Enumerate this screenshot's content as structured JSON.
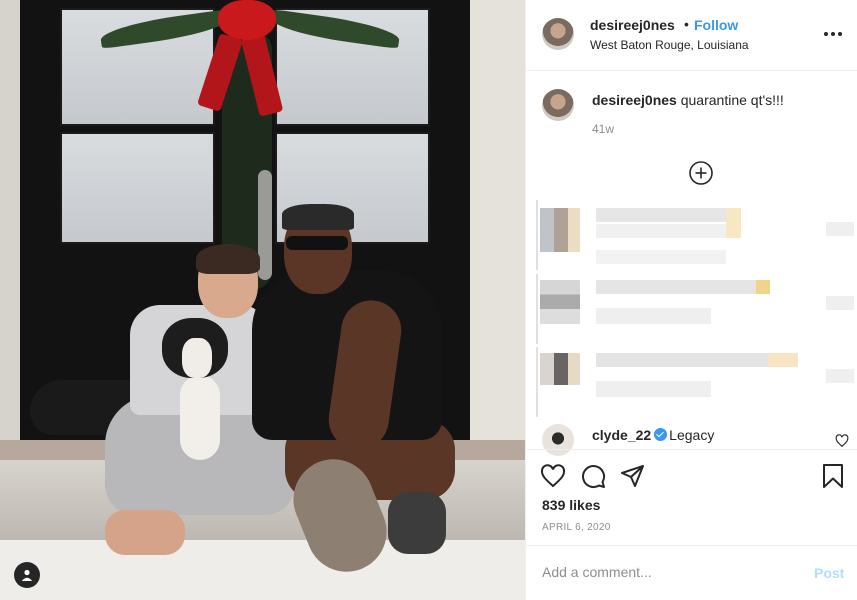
{
  "post": {
    "username": "desireej0nes",
    "separator": "•",
    "follow_label": "Follow",
    "location": "West Baton Rouge, Louisiana",
    "caption_user": "desireej0nes",
    "caption_text": "quarantine qt's!!!",
    "caption_time": "41w",
    "likes": "839 likes",
    "date": "APRIL 6, 2020"
  },
  "comments": {
    "visible_comment_user": "clyde_22",
    "visible_comment_text": "Legacy",
    "verified": true
  },
  "add_comment": {
    "placeholder": "Add a comment...",
    "post_label": "Post"
  },
  "icons": {
    "more": "more-options-icon",
    "load_more": "plus-circle-icon",
    "like": "heart-icon",
    "comment": "comment-icon",
    "share": "paper-plane-icon",
    "save": "bookmark-icon",
    "user": "user-tag-icon"
  },
  "colors": {
    "accent": "#3897f0",
    "post_disabled": "#b2dffc",
    "muted": "#8e8e8e",
    "text": "#262626"
  }
}
